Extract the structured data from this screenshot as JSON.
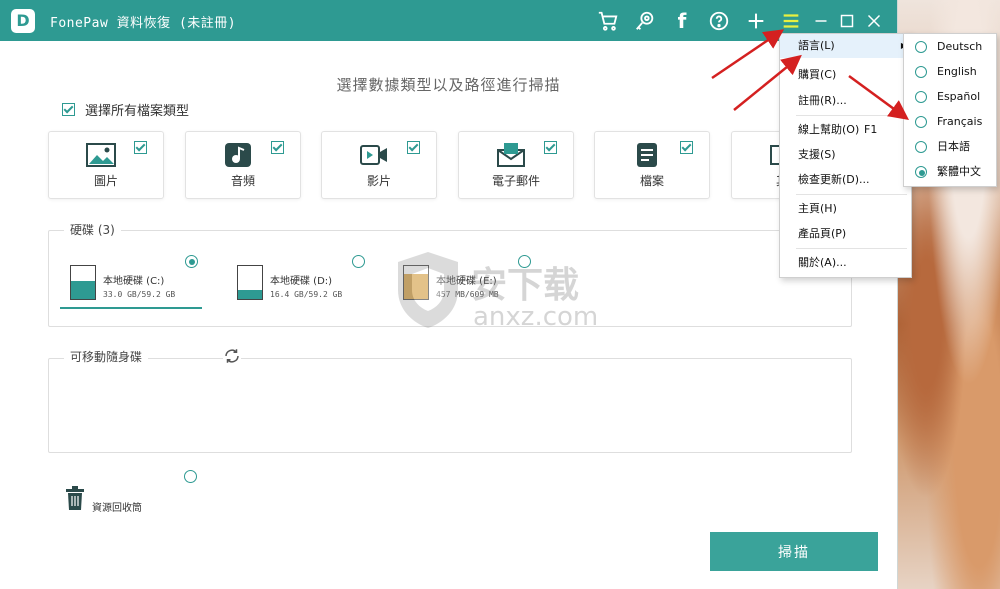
{
  "titlebar": {
    "logo": "D",
    "app_name": "FonePaw 資料恢復 (未註冊)",
    "icons": [
      "cart-icon",
      "key-icon",
      "facebook-icon",
      "help-icon",
      "plus-icon",
      "menu-icon",
      "minimize-icon",
      "maximize-icon",
      "close-icon"
    ]
  },
  "headline": "選擇數據類型以及路徑進行掃描",
  "select_all_label": "選擇所有檔案類型",
  "file_types": [
    {
      "label": "圖片",
      "icon": "image-icon"
    },
    {
      "label": "音頻",
      "icon": "music-icon"
    },
    {
      "label": "影片",
      "icon": "video-icon"
    },
    {
      "label": "電子郵件",
      "icon": "email-icon"
    },
    {
      "label": "檔案",
      "icon": "document-icon"
    },
    {
      "label": "其",
      "icon": "other-icon"
    }
  ],
  "hard_drives": {
    "title": "硬碟 (3)",
    "drives": [
      {
        "name": "本地硬碟 (C:)",
        "size": "33.0 GB/59.2 GB",
        "used_fraction": 0.56,
        "selected": true
      },
      {
        "name": "本地硬碟 (D:)",
        "size": "16.4 GB/59.2 GB",
        "used_fraction": 0.28,
        "selected": false
      },
      {
        "name": "本地硬碟 (E:)",
        "size": "457 MB/609 MB",
        "used_fraction": 0.75,
        "selected": false
      }
    ]
  },
  "removable": {
    "title": "可移動隨身碟",
    "refresh_icon": "refresh-icon"
  },
  "recycle": {
    "label": "資源回收筒",
    "icon": "trash-icon"
  },
  "scan_button": "掃描",
  "menu": {
    "items": [
      {
        "label": "語言(L)",
        "submenu": true,
        "shortcut": ""
      },
      {
        "label": "購買(C)",
        "shortcut": ""
      },
      {
        "label": "註冊(R)...",
        "shortcut": ""
      },
      {
        "label": "線上幫助(O)",
        "shortcut": "F1"
      },
      {
        "label": "支援(S)",
        "shortcut": ""
      },
      {
        "label": "檢查更新(D)...",
        "shortcut": ""
      },
      {
        "label": "主頁(H)",
        "shortcut": ""
      },
      {
        "label": "產品頁(P)",
        "shortcut": ""
      },
      {
        "label": "關於(A)...",
        "shortcut": ""
      }
    ]
  },
  "languages": [
    {
      "label": "Deutsch",
      "selected": false
    },
    {
      "label": "English",
      "selected": false
    },
    {
      "label": "Español",
      "selected": false
    },
    {
      "label": "Français",
      "selected": false
    },
    {
      "label": "日本語",
      "selected": false
    },
    {
      "label": "繁體中文",
      "selected": true
    }
  ],
  "watermark": {
    "text": "安下载",
    "sub": "anxz.com"
  },
  "colors": {
    "accent": "#2e9a92",
    "arrow": "#d42020"
  }
}
